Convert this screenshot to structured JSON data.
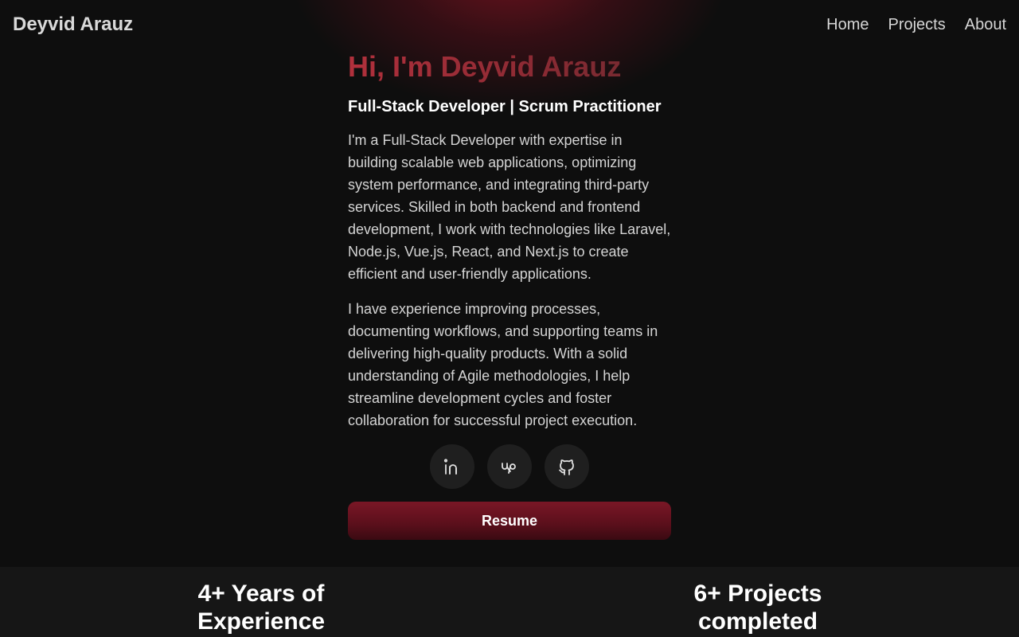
{
  "header": {
    "brand": "Deyvid Arauz",
    "nav": [
      {
        "label": "Home"
      },
      {
        "label": "Projects"
      },
      {
        "label": "About"
      }
    ]
  },
  "hero": {
    "title": "Hi, I'm Deyvid Arauz",
    "subtitle": "Full-Stack Developer | Scrum Practitioner",
    "bio": [
      "I'm a Full-Stack Developer with expertise in building scalable web applications, optimizing system performance, and integrating third-party services. Skilled in both backend and frontend development, I work with technologies like Laravel, Node.js, Vue.js, React, and Next.js to create efficient and user-friendly applications.",
      "I have experience improving processes, documenting workflows, and supporting teams in delivering high-quality products. With a solid understanding of Agile methodologies, I help streamline development cycles and foster collaboration for successful project execution."
    ],
    "socials": [
      {
        "icon": "linkedin-icon"
      },
      {
        "icon": "upwork-icon"
      },
      {
        "icon": "github-icon"
      }
    ],
    "resume_label": "Resume"
  },
  "stats": [
    {
      "line1": "4+ Years of",
      "line2": "Experience"
    },
    {
      "line1": "6+ Projects",
      "line2": "completed"
    }
  ],
  "colors": {
    "accent": "#b1303c",
    "button": "#7a1726",
    "background": "#0e0e0e"
  }
}
